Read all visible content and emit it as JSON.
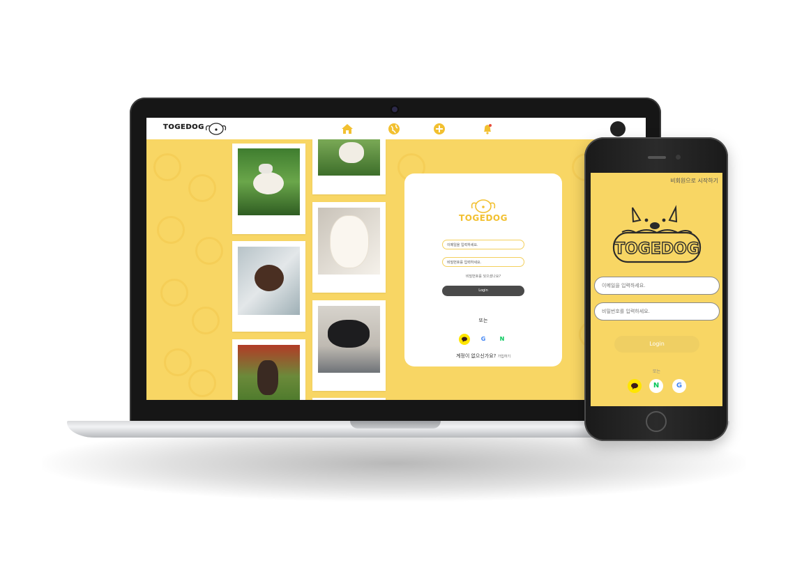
{
  "laptop": {
    "brand": "TOGEDOG",
    "nav_icons": [
      "home-icon",
      "globe-icon",
      "plus-circle-icon",
      "bell-icon"
    ],
    "login": {
      "brand": "TOGEDOG",
      "email_placeholder": "이메일을 입력하세요.",
      "password_placeholder": "비밀번호를 입력하세요.",
      "forgot_password": "비밀번호를 잊으셨나요?",
      "login_button": "Login",
      "or": "또는",
      "no_account": "계정이 없으신가요?",
      "signup": "가입하기"
    }
  },
  "phone": {
    "guest_link": "비회원으로 시작하기",
    "brand": "TOGEDOG",
    "email_placeholder": "이메일을 입력하세요.",
    "password_placeholder": "비밀번호를 입력하세요.",
    "login_button": "Login",
    "or": "또는"
  },
  "social": {
    "naver_letter": "N",
    "google_letter": "G"
  },
  "colors": {
    "brand_yellow": "#f8d664",
    "accent_yellow": "#f2c030",
    "dark_button": "#4a4a4a",
    "kakao": "#ffe600",
    "naver": "#03c75a"
  }
}
